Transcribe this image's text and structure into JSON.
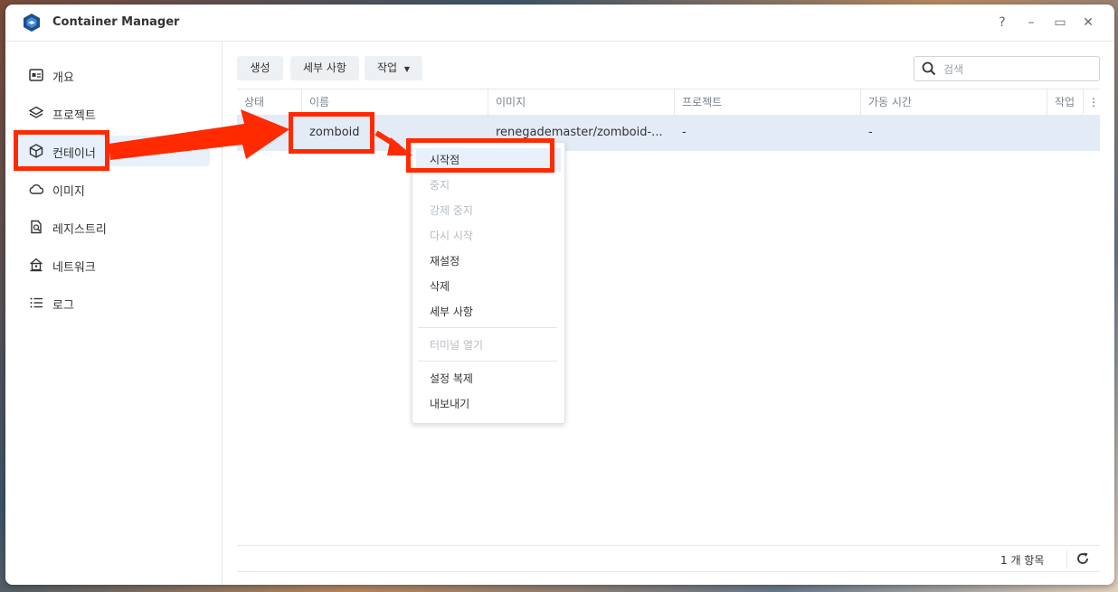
{
  "window": {
    "title": "Container Manager"
  },
  "window_controls": {
    "help": "?",
    "minimize": "–",
    "maximize": "▭",
    "close": "✕"
  },
  "sidebar": {
    "items": [
      {
        "label": "개요",
        "icon": "overview-icon"
      },
      {
        "label": "프로젝트",
        "icon": "layers-icon"
      },
      {
        "label": "컨테이너",
        "icon": "cube-icon",
        "active": true
      },
      {
        "label": "이미지",
        "icon": "cloud-icon"
      },
      {
        "label": "레지스트리",
        "icon": "registry-search-icon"
      },
      {
        "label": "네트워크",
        "icon": "network-icon"
      },
      {
        "label": "로그",
        "icon": "list-icon"
      }
    ]
  },
  "toolbar": {
    "create": "생성",
    "details": "세부 사항",
    "action": "작업"
  },
  "search": {
    "placeholder": "검색"
  },
  "table": {
    "columns": [
      "상태",
      "이름",
      "이미지",
      "프로젝트",
      "가동 시간",
      "작업"
    ],
    "rows": [
      {
        "name": "zomboid",
        "image": "renegademaster/zomboid-...",
        "project": "-",
        "uptime": "-"
      }
    ]
  },
  "context_menu": {
    "items": [
      {
        "label": "시작점",
        "enabled": true
      },
      {
        "label": "중지",
        "enabled": false
      },
      {
        "label": "강제 중지",
        "enabled": false
      },
      {
        "label": "다시 시작",
        "enabled": false
      },
      {
        "label": "재설정",
        "enabled": true
      },
      {
        "label": "삭제",
        "enabled": true
      },
      {
        "label": "세부 사항",
        "enabled": true
      },
      {
        "label": "터미널 열기",
        "enabled": false
      },
      {
        "label": "설정 복제",
        "enabled": true
      },
      {
        "label": "내보내기",
        "enabled": true
      }
    ]
  },
  "footer": {
    "count": "1 개 항목"
  },
  "colors": {
    "accent": "#ff2a00",
    "selected_row": "#e3ebf7",
    "active_nav": "#e8f0fb"
  }
}
